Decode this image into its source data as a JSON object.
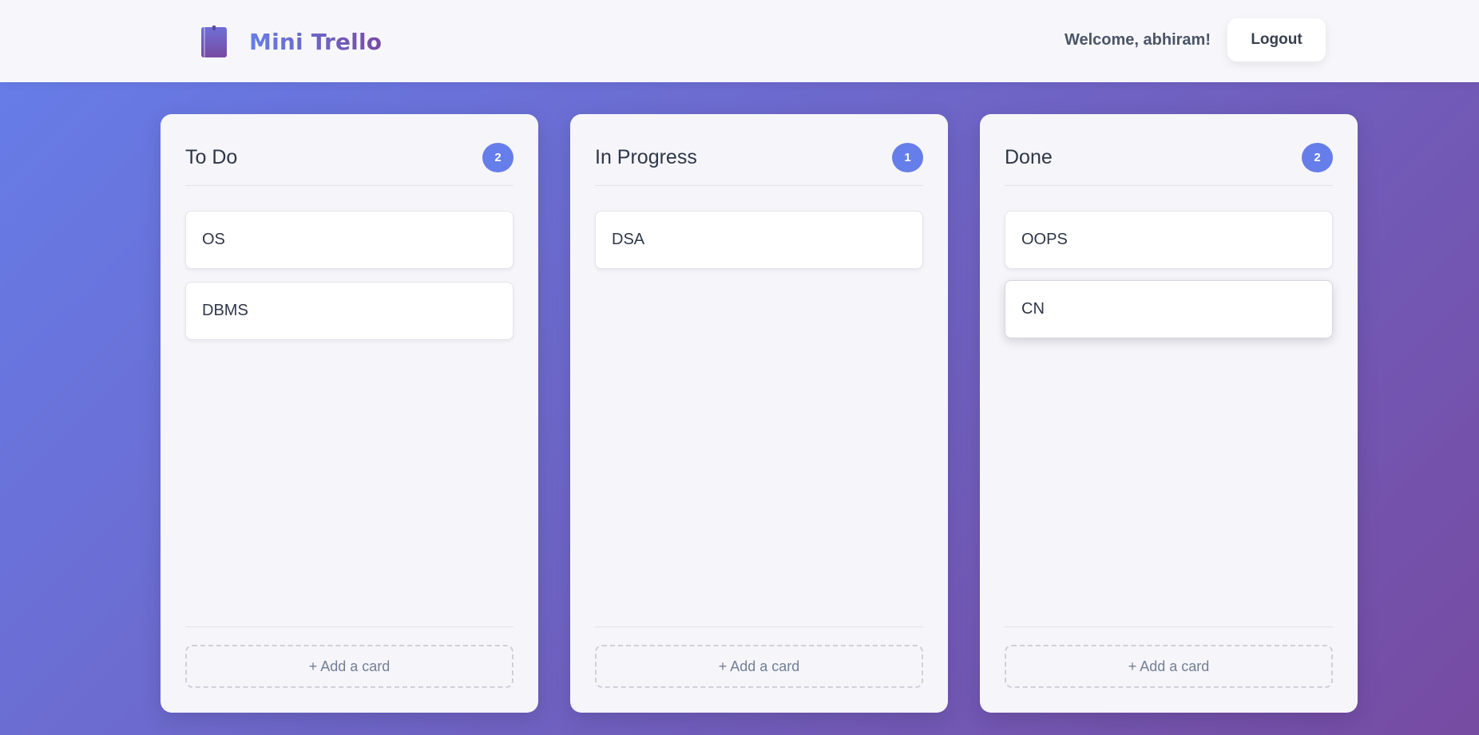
{
  "header": {
    "title": "Mini Trello",
    "welcome": "Welcome, abhiram!",
    "logout_label": "Logout"
  },
  "columns": [
    {
      "title": "To Do",
      "count": "2",
      "cards": [
        "OS",
        "DBMS"
      ],
      "add_label": "+ Add a card"
    },
    {
      "title": "In Progress",
      "count": "1",
      "cards": [
        "DSA"
      ],
      "add_label": "+ Add a card"
    },
    {
      "title": "Done",
      "count": "2",
      "cards": [
        "OOPS",
        "CN"
      ],
      "add_label": "+ Add a card"
    }
  ],
  "colors": {
    "accent": "#667eea",
    "accent_secondary": "#764ba2",
    "column_bg": "#f6f5fa",
    "text": "#2d3748"
  },
  "icons": {
    "brand": "notebook-icon"
  }
}
